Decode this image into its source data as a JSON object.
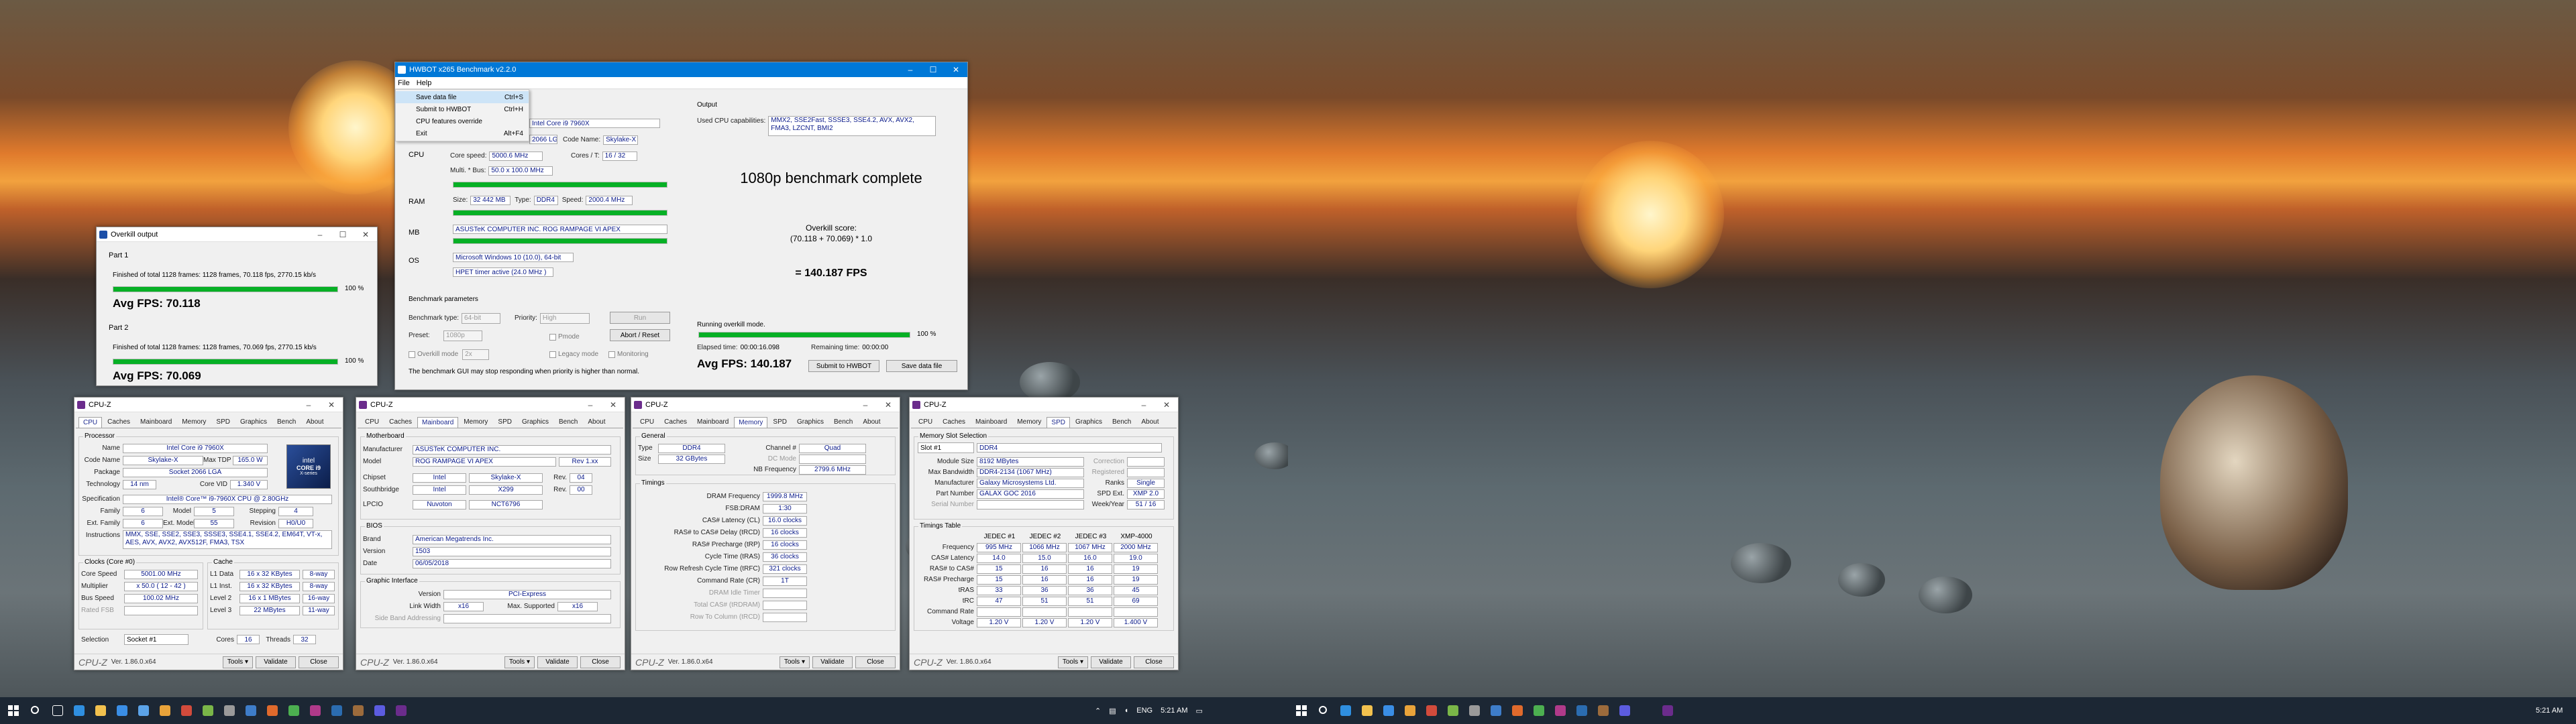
{
  "desktop": {
    "clock1": "5:21 AM",
    "clock2": "5:21 AM",
    "lang": "ENG"
  },
  "overkill": {
    "title": "Overkill output",
    "part1": "Part 1",
    "p1line": "Finished of total 1128 frames: 1128 frames, 70.118 fps, 2770.15 kb/s",
    "p1pct": "100 %",
    "p1avg": "Avg FPS: 70.118",
    "part2": "Part 2",
    "p2line": "Finished of total 1128 frames: 1128 frames, 70.069 fps, 2770.15 kb/s",
    "p2pct": "100 %",
    "p2avg": "Avg FPS: 70.069"
  },
  "bench": {
    "title": "HWBOT x265 Benchmark v2.2.0",
    "menu_file": "File",
    "menu_help": "Help",
    "menu_items": [
      {
        "l": "Save data file",
        "k": "Ctrl+S"
      },
      {
        "l": "Submit to HWBOT",
        "k": "Ctrl+H"
      },
      {
        "l": "CPU features override",
        "k": ""
      },
      {
        "l": "Exit",
        "k": "Alt+F4"
      }
    ],
    "cpu_lbl": "CPU",
    "cpu_name": "Intel Core i9 7960X",
    "cpu_pkg": "2066 LGA",
    "code_lbl": "Code Name:",
    "code_val": "Skylake-X",
    "cores_lbl": "Cores / T:",
    "cores_val": "16 / 32",
    "speed_lbl": "Core speed:",
    "speed_val": "5000.6 MHz",
    "mult_lbl": "Multi. * Bus:",
    "mult_val": "50.0 x 100.0 MHz",
    "ram_lbl": "RAM",
    "size_lbl": "Size:",
    "size_val": "32 442 MB",
    "type_lbl": "Type:",
    "type_val": "DDR4",
    "rspeed_lbl": "Speed:",
    "rspeed_val": "2000.4 MHz",
    "mb_lbl": "MB",
    "mb_val": "ASUSTeK COMPUTER INC. ROG RAMPAGE VI APEX",
    "os_lbl": "OS",
    "os_val": "Microsoft Windows 10 (10.0), 64-bit",
    "timer_val": "HPET timer active (24.0 MHz )",
    "params": "Benchmark parameters",
    "btype_lbl": "Benchmark type:",
    "btype_val": "64-bit",
    "prio_lbl": "Priority:",
    "prio_val": "High",
    "run": "Run",
    "preset_lbl": "Preset:",
    "preset_val": "1080p",
    "pmode": "Pmode",
    "abort": "Abort / Reset",
    "overkill_mode": "Overkill mode",
    "overkill_val": "2x",
    "legacy": "Legacy mode",
    "monitoring": "Monitoring",
    "warn": "The benchmark GUI may stop responding when priority is higher than normal.",
    "output": "Output",
    "caps_lbl": "Used CPU capabilities:",
    "caps_val": "MMX2, SSE2Fast, SSSE3, SSE4.2, AVX, AVX2, FMA3, LZCNT, BMI2",
    "complete": "1080p benchmark complete",
    "score_lbl": "Overkill score:",
    "score_formula": "(70.118 + 70.069) * 1.0",
    "score_val": "= 140.187 FPS",
    "running": "Running overkill mode.",
    "pct": "100 %",
    "elapsed_lbl": "Elapsed time:",
    "elapsed": "00:00:16.098",
    "remain_lbl": "Remaining time:",
    "remain": "00:00:00",
    "avg": "Avg FPS: 140.187",
    "submit": "Submit to HWBOT",
    "save": "Save data file"
  },
  "cpuz": {
    "title": "CPU-Z",
    "ver": "Ver. 1.86.0.x64",
    "tools": "Tools",
    "validate": "Validate",
    "close": "Close",
    "tabs": [
      "CPU",
      "Caches",
      "Mainboard",
      "Memory",
      "SPD",
      "Graphics",
      "Bench",
      "About"
    ],
    "cpu": {
      "processor": "Processor",
      "name_l": "Name",
      "name": "Intel Core i9 7960X",
      "code_l": "Code Name",
      "code": "Skylake-X",
      "tdp_l": "Max TDP",
      "tdp": "165.0 W",
      "pkg_l": "Package",
      "pkg": "Socket 2066 LGA",
      "tech_l": "Technology",
      "tech": "14 nm",
      "vid_l": "Core VID",
      "vid": "1.340 V",
      "spec_l": "Specification",
      "spec": "Intel® Core™ i9-7960X CPU @ 2.80GHz",
      "fam_l": "Family",
      "fam": "6",
      "model_l": "Model",
      "model": "5",
      "step_l": "Stepping",
      "step": "4",
      "efam_l": "Ext. Family",
      "efam": "6",
      "emod_l": "Ext. Model",
      "emod": "55",
      "rev_l": "Revision",
      "rev": "H0/U0",
      "inst_l": "Instructions",
      "inst": "MMX, SSE, SSE2, SSE3, SSSE3, SSE4.1, SSE4.2, EM64T, VT-x, AES, AVX, AVX2, AVX512F, FMA3, TSX",
      "clocks": "Clocks (Core #0)",
      "cs_l": "Core Speed",
      "cs": "5001.00 MHz",
      "mul_l": "Multiplier",
      "mul": "x 50.0 ( 12 - 42 )",
      "bus_l": "Bus Speed",
      "bus": "100.02 MHz",
      "fsb_l": "Rated FSB",
      "cache": "Cache",
      "l1d_l": "L1 Data",
      "l1d": "16 x 32 KBytes",
      "l1d_w": "8-way",
      "l1i_l": "L1 Inst.",
      "l1i": "16 x 32 KBytes",
      "l1i_w": "8-way",
      "l2_l": "Level 2",
      "l2": "16 x 1 MBytes",
      "l2_w": "16-way",
      "l3_l": "Level 3",
      "l3": "22 MBytes",
      "l3_w": "11-way",
      "sel_l": "Selection",
      "sel": "Socket #1",
      "cores_l": "Cores",
      "cores": "16",
      "thr_l": "Threads",
      "thr": "32",
      "chip_a": "intel",
      "chip_b": "CORE i9",
      "chip_c": "X-series"
    },
    "mb": {
      "mb": "Motherboard",
      "man_l": "Manufacturer",
      "man": "ASUSTeK COMPUTER INC.",
      "model_l": "Model",
      "model": "ROG RAMPAGE VI APEX",
      "model_rev": "Rev 1.xx",
      "chip_l": "Chipset",
      "chip": "Intel",
      "chip_v": "Skylake-X",
      "rev_l": "Rev.",
      "chip_r": "04",
      "south_l": "Southbridge",
      "south": "Intel",
      "south_v": "X299",
      "south_r": "00",
      "lpc_l": "LPCIO",
      "lpc": "Nuvoton",
      "lpc_v": "NCT6796",
      "bios": "BIOS",
      "brand_l": "Brand",
      "brand": "American Megatrends Inc.",
      "ver_l": "Version",
      "ver": "1503",
      "date_l": "Date",
      "date": "06/05/2018",
      "gi": "Graphic Interface",
      "gv_l": "Version",
      "gv": "PCI-Express",
      "lw_l": "Link Width",
      "lw": "x16",
      "ms_l": "Max. Supported",
      "ms": "x16",
      "sba_l": "Side Band Addressing"
    },
    "mem": {
      "general": "General",
      "type_l": "Type",
      "type": "DDR4",
      "ch_l": "Channel #",
      "ch": "Quad",
      "size_l": "Size",
      "size": "32 GBytes",
      "dc_l": "DC Mode",
      "nb_l": "NB Frequency",
      "nb": "2799.6 MHz",
      "timings": "Timings",
      "rows": [
        {
          "l": "DRAM Frequency",
          "v": "1999.8 MHz"
        },
        {
          "l": "FSB:DRAM",
          "v": "1:30"
        },
        {
          "l": "CAS# Latency (CL)",
          "v": "16.0 clocks"
        },
        {
          "l": "RAS# to CAS# Delay (tRCD)",
          "v": "16 clocks"
        },
        {
          "l": "RAS# Precharge (tRP)",
          "v": "16 clocks"
        },
        {
          "l": "Cycle Time (tRAS)",
          "v": "36 clocks"
        },
        {
          "l": "Row Refresh Cycle Time (tRFC)",
          "v": "321 clocks"
        },
        {
          "l": "Command Rate (CR)",
          "v": "1T"
        },
        {
          "l": "DRAM Idle Timer",
          "v": ""
        },
        {
          "l": "Total CAS# (tRDRAM)",
          "v": ""
        },
        {
          "l": "Row To Column (tRCD)",
          "v": ""
        }
      ]
    },
    "spd": {
      "sel": "Memory Slot Selection",
      "slot": "Slot #1",
      "type": "DDR4",
      "ms_l": "Module Size",
      "ms": "8192 MBytes",
      "corr_l": "Correction",
      "bw_l": "Max Bandwidth",
      "bw": "DDR4-2134 (1067 MHz)",
      "reg_l": "Registered",
      "man_l": "Manufacturer",
      "man": "Galaxy Microsystems Ltd.",
      "ranks_l": "Ranks",
      "ranks": "Single",
      "pn_l": "Part Number",
      "pn": "GALAX GOC 2016",
      "spdx_l": "SPD Ext.",
      "spdx": "XMP 2.0",
      "sn_l": "Serial Number",
      "wy_l": "Week/Year",
      "wy": "51 / 16",
      "tt": "Timings Table",
      "cols": [
        "JEDEC #1",
        "JEDEC #2",
        "JEDEC #3",
        "XMP-4000"
      ],
      "trows": [
        {
          "l": "Frequency",
          "v": [
            "995 MHz",
            "1066 MHz",
            "1067 MHz",
            "2000 MHz"
          ]
        },
        {
          "l": "CAS# Latency",
          "v": [
            "14.0",
            "15.0",
            "16.0",
            "19.0"
          ]
        },
        {
          "l": "RAS# to CAS#",
          "v": [
            "15",
            "16",
            "16",
            "19"
          ]
        },
        {
          "l": "RAS# Precharge",
          "v": [
            "15",
            "16",
            "16",
            "19"
          ]
        },
        {
          "l": "tRAS",
          "v": [
            "33",
            "36",
            "36",
            "45"
          ]
        },
        {
          "l": "tRC",
          "v": [
            "47",
            "51",
            "51",
            "69"
          ]
        },
        {
          "l": "Command Rate",
          "v": [
            "",
            "",
            "",
            ""
          ]
        },
        {
          "l": "Voltage",
          "v": [
            "1.20 V",
            "1.20 V",
            "1.20 V",
            "1.400 V"
          ]
        }
      ]
    }
  }
}
